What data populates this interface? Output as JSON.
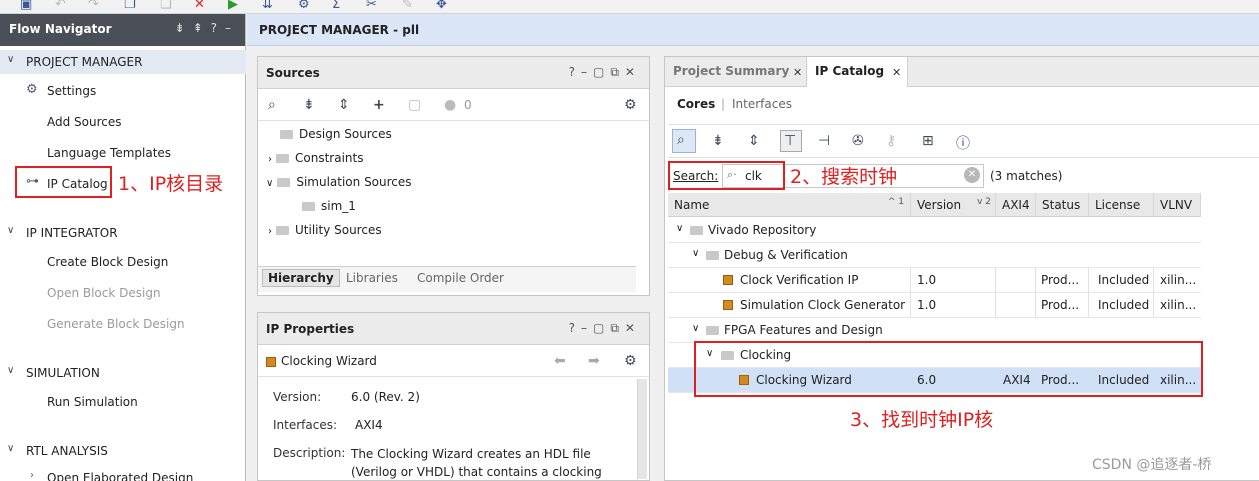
{
  "flow_navigator": {
    "title": "Flow Navigator",
    "sections": {
      "project_manager": "PROJECT MANAGER",
      "ip_integrator": "IP INTEGRATOR",
      "simulation": "SIMULATION",
      "rtl_analysis": "RTL ANALYSIS"
    },
    "items": {
      "settings": "Settings",
      "add_sources": "Add Sources",
      "language_templates": "Language Templates",
      "ip_catalog": "IP Catalog",
      "create_block_design": "Create Block Design",
      "open_block_design": "Open Block Design",
      "generate_block_design": "Generate Block Design",
      "run_simulation": "Run Simulation",
      "open_elaborated_design": "Open Elaborated Design"
    }
  },
  "header": {
    "title": "PROJECT MANAGER - pll"
  },
  "sources": {
    "title": "Sources",
    "count": "0",
    "tree": {
      "design_sources": "Design Sources",
      "constraints": "Constraints",
      "simulation_sources": "Simulation Sources",
      "sim_1": "sim_1",
      "utility_sources": "Utility Sources"
    },
    "tabs": {
      "hierarchy": "Hierarchy",
      "libraries": "Libraries",
      "compile_order": "Compile Order"
    }
  },
  "ip_properties": {
    "title": "IP Properties",
    "name": "Clocking Wizard",
    "version_label": "Version:",
    "version_value": "6.0 (Rev. 2)",
    "interfaces_label": "Interfaces:",
    "interfaces_value": "AXI4",
    "description_label": "Description:",
    "description_line1": "The Clocking Wizard creates an HDL file",
    "description_line2": "(Verilog or VHDL) that contains a clocking"
  },
  "ip_catalog": {
    "tabs": {
      "project_summary": "Project Summary",
      "ip_catalog": "IP Catalog"
    },
    "subtabs": {
      "cores": "Cores",
      "separator": "|",
      "interfaces": "Interfaces"
    },
    "search": {
      "label": "Search:",
      "value": "clk",
      "matches": "(3 matches)"
    },
    "columns": {
      "name": "Name",
      "name_sort": "^ 1",
      "version": "Version",
      "version_sort": "v 2",
      "axi4": "AXI4",
      "status": "Status",
      "license": "License",
      "vlnv": "VLNV"
    },
    "rows": {
      "repo": "Vivado Repository",
      "debug": "Debug & Verification",
      "clock_verif": {
        "name": "Clock Verification IP",
        "version": "1.0",
        "axi4": "",
        "status": "Prod...",
        "license": "Included",
        "vlnv": "xilin..."
      },
      "sim_clock": {
        "name": "Simulation Clock Generator",
        "version": "1.0",
        "axi4": "",
        "status": "Prod...",
        "license": "Included",
        "vlnv": "xilin..."
      },
      "fpga": "FPGA Features and Design",
      "clocking": "Clocking",
      "clocking_wizard": {
        "name": "Clocking Wizard",
        "version": "6.0",
        "axi4": "AXI4",
        "status": "Prod...",
        "license": "Included",
        "vlnv": "xilin..."
      }
    }
  },
  "annotations": {
    "a1": "1、IP核目录",
    "a2": "2、搜索时钟",
    "a3": "3、找到时钟IP核"
  },
  "watermark": "CSDN @追逐者-桥",
  "colors": {
    "annotation_red": "#e02020",
    "nav_header": "#4a4f57",
    "selected_row": "#cfe0f7"
  }
}
